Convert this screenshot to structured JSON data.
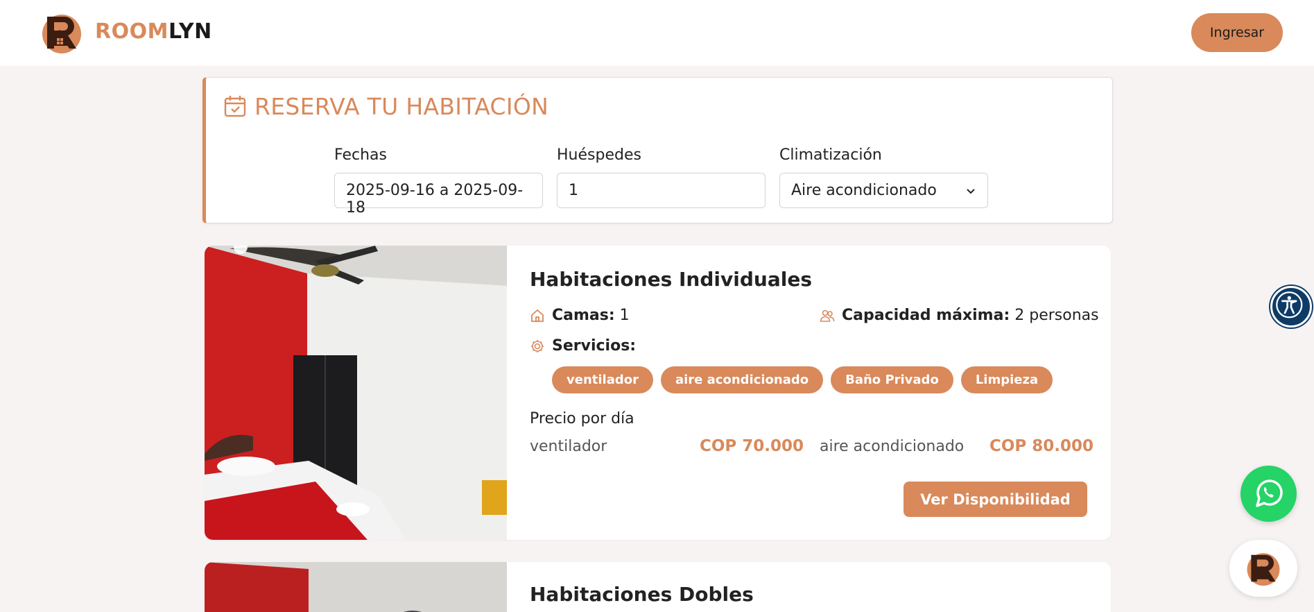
{
  "brand": {
    "name_part1": "ROOM",
    "name_part2": "LYN"
  },
  "header": {
    "login_label": "Ingresar"
  },
  "booking": {
    "title": "RESERVA TU HABITACIÓN",
    "dates_label": "Fechas",
    "dates_value": "2025-09-16 a 2025-09-18",
    "guests_label": "Huéspedes",
    "guests_value": "1",
    "climate_label": "Climatización",
    "climate_value": "Aire acondicionado"
  },
  "rooms": [
    {
      "title": "Habitaciones Individuales",
      "beds_label": "Camas:",
      "beds_value": "1",
      "capacity_label": "Capacidad máxima:",
      "capacity_value": "2 personas",
      "services_label": "Servicios:",
      "services": [
        "ventilador",
        "aire acondicionado",
        "Baño Privado",
        "Limpieza"
      ],
      "price_title": "Precio por día",
      "prices": [
        {
          "label": "ventilador",
          "value": "COP 70.000"
        },
        {
          "label": "aire acondicionado",
          "value": "COP 80.000"
        }
      ],
      "cta": "Ver Disponibilidad"
    },
    {
      "title": "Habitaciones Dobles"
    }
  ],
  "colors": {
    "accent": "#d9895a",
    "accessibility": "#0d3b66",
    "whatsapp": "#25d366"
  },
  "icons": [
    "logo-icon",
    "calendar-icon",
    "chevron-down-icon",
    "home-icon",
    "users-icon",
    "gear-icon",
    "accessibility-icon",
    "whatsapp-icon"
  ]
}
